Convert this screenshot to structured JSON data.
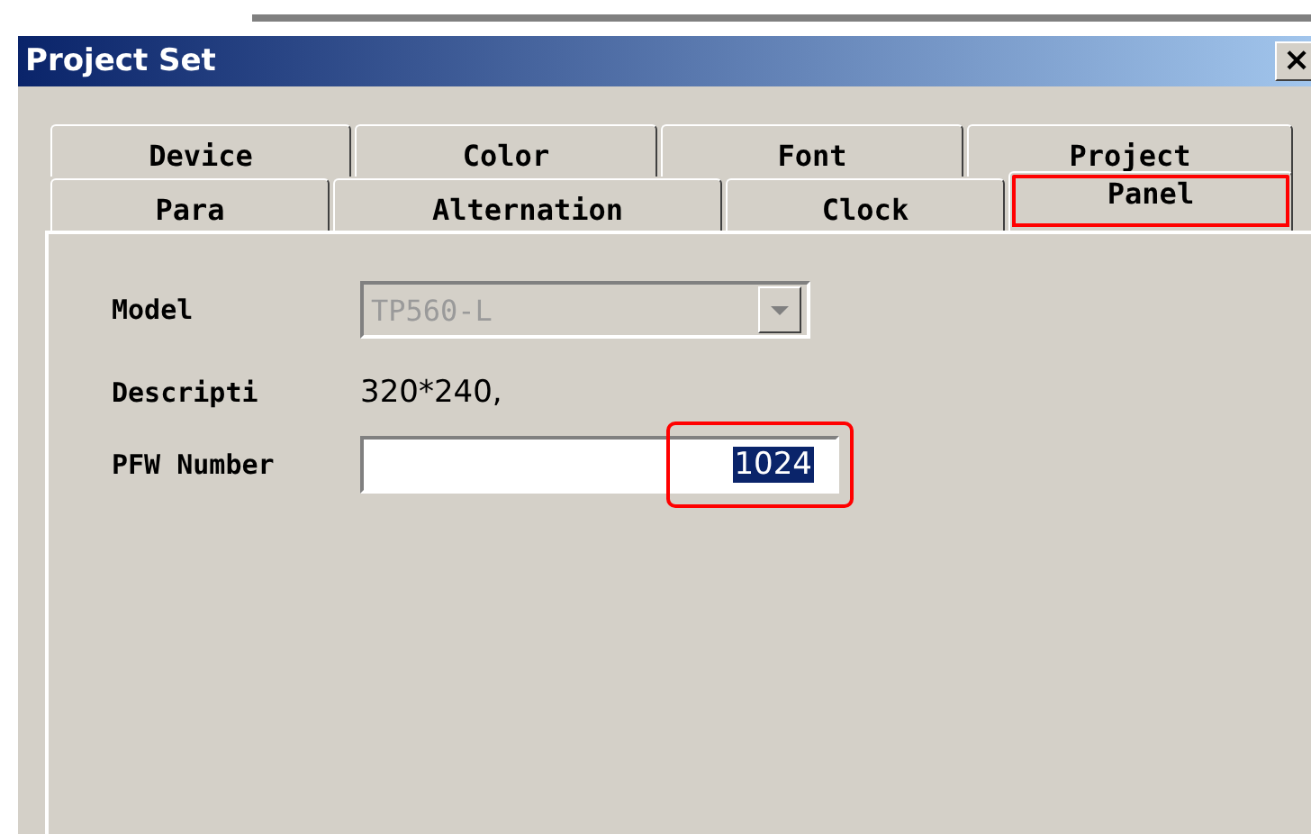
{
  "window": {
    "title": "Project Set",
    "close": "×"
  },
  "tab_rows": [
    [
      {
        "label": "Device",
        "selected": false,
        "highlighted": false
      },
      {
        "label": "Color",
        "selected": false,
        "highlighted": false
      },
      {
        "label": "Font",
        "selected": false,
        "highlighted": false
      },
      {
        "label": "Project",
        "selected": false,
        "highlighted": false
      }
    ],
    [
      {
        "label": "Para",
        "selected": false,
        "highlighted": false
      },
      {
        "label": "Alternation",
        "selected": false,
        "highlighted": false
      },
      {
        "label": "Clock",
        "selected": false,
        "highlighted": false
      },
      {
        "label": "Panel",
        "selected": true,
        "highlighted": true
      }
    ]
  ],
  "fields": [
    {
      "kind": "dropdown",
      "label": "Model",
      "value": "TP560-L",
      "disabled": true
    },
    {
      "kind": "text",
      "label": "Descripti",
      "value": "320*240,"
    },
    {
      "kind": "input",
      "label": "PFW Number",
      "value": "1024",
      "highlighted": true
    }
  ]
}
